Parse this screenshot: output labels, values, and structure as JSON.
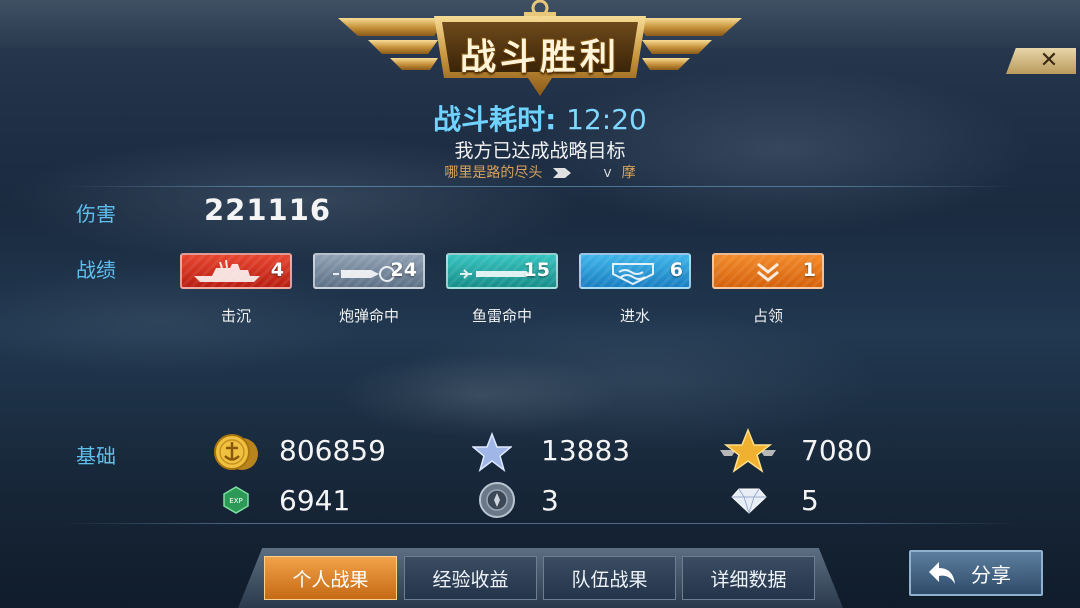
{
  "title": "战斗胜利",
  "close_label": "✕",
  "duration": {
    "label": "战斗耗时:",
    "value": "12:20"
  },
  "subtitle": "我方已达成战略目标",
  "player": {
    "name": "哪里是路的尽头",
    "tag": "V",
    "extra": "摩"
  },
  "damage": {
    "label": "伤害",
    "value": "221116"
  },
  "record": {
    "label": "战绩",
    "items": [
      {
        "name": "击沉",
        "count": "4",
        "icon": "ship-silhouette-icon"
      },
      {
        "name": "炮弹命中",
        "count": "24",
        "icon": "shell-icon"
      },
      {
        "name": "鱼雷命中",
        "count": "15",
        "icon": "torpedo-icon"
      },
      {
        "name": "进水",
        "count": "6",
        "icon": "water-icon"
      },
      {
        "name": "占领",
        "count": "1",
        "icon": "chevron-icon"
      }
    ]
  },
  "base": {
    "label": "基础",
    "stats": [
      {
        "icon": "gold-coin-icon",
        "value": "806859"
      },
      {
        "icon": "silver-star-icon",
        "value": "13883"
      },
      {
        "icon": "gold-star-wings-icon",
        "value": "7080"
      },
      {
        "icon": "exp-icon",
        "value": "6941"
      },
      {
        "icon": "steel-badge-icon",
        "value": "3"
      },
      {
        "icon": "diamond-icon",
        "value": "5"
      }
    ]
  },
  "tabs": [
    "个人战果",
    "经验收益",
    "队伍战果",
    "详细数据"
  ],
  "share_label": "分享",
  "colors": {
    "accent_blue": "#5fc0f0",
    "tab_active": "#e88a2c",
    "gold": "#d9a25a"
  }
}
